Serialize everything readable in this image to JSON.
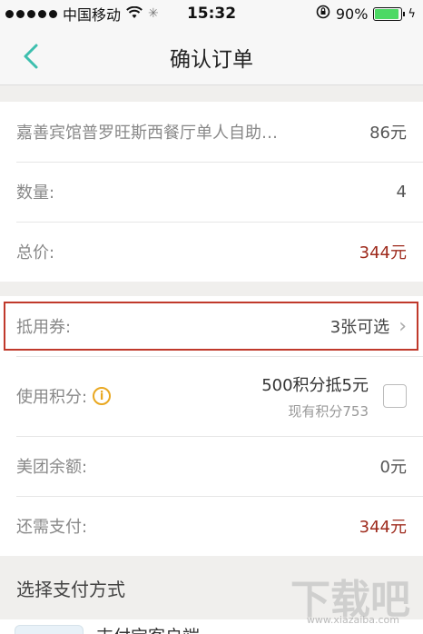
{
  "status_bar": {
    "carrier": "中国移动",
    "time": "15:32",
    "battery": "90%",
    "battery_level": 0.9
  },
  "navbar": {
    "title": "确认订单"
  },
  "order": {
    "item_name": "嘉善宾馆普罗旺斯西餐厅单人自助…",
    "item_price": "86元",
    "quantity_label": "数量:",
    "quantity_value": "4",
    "total_label": "总价:",
    "total_value": "344元"
  },
  "discounts": {
    "coupon_label": "抵用券:",
    "coupon_value": "3张可选",
    "points_label": "使用积分:",
    "points_main": "500积分抵5元",
    "points_sub": "现有积分753",
    "balance_label": "美团余额:",
    "balance_value": "0元",
    "due_label": "还需支付:",
    "due_value": "344元"
  },
  "payment": {
    "section_title": "选择支付方式",
    "first_method": "支付宝客户端"
  },
  "watermark": {
    "main": "下载吧",
    "sub": "www.xiazaiba.com"
  },
  "colors": {
    "accent": "#3dbfae",
    "price": "#9e2a1c",
    "highlight_box": "#c0392b",
    "info_icon": "#e9a821"
  }
}
